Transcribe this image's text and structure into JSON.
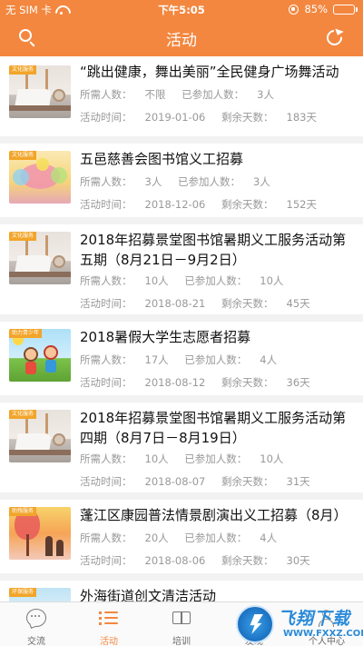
{
  "status_bar": {
    "carrier": "无 SIM 卡",
    "time": "下午5:05",
    "battery": "85%",
    "battery_level": 0.85
  },
  "nav": {
    "title": "活动",
    "search_icon": "search-icon",
    "refresh_icon": "refresh-icon"
  },
  "labels": {
    "need": "所需人数：",
    "joined": "已参加人数：",
    "time": "活动时间：",
    "remain": "剩余天数："
  },
  "activities": [
    {
      "title": "“跳出健康，舞出美丽”全民健身广场舞活动",
      "need": "不限",
      "joined": "3人",
      "date": "2019-01-06",
      "remain": "183天",
      "thumb_tag": "文化服务",
      "thumb_art": "book"
    },
    {
      "title": "五邑慈善会图书馆义工招募",
      "need": "3人",
      "joined": "3人",
      "date": "2018-12-06",
      "remain": "152天",
      "thumb_tag": "文化服务",
      "thumb_art": "tree"
    },
    {
      "title": "2018年招募景堂图书馆暑期义工服务活动第五期（8月21日－9月2日）",
      "need": "10人",
      "joined": "10人",
      "date": "2018-08-21",
      "remain": "45天",
      "thumb_tag": "文化服务",
      "thumb_art": "book"
    },
    {
      "title": "2018暑假大学生志愿者招募",
      "need": "17人",
      "joined": "4人",
      "date": "2018-08-12",
      "remain": "36天",
      "thumb_tag": "助力青少年",
      "thumb_art": "kids"
    },
    {
      "title": "2018年招募景堂图书馆暑期义工服务活动第四期（8月7日－8月19日）",
      "need": "10人",
      "joined": "10人",
      "date": "2018-08-07",
      "remain": "31天",
      "thumb_tag": "文化服务",
      "thumb_art": "book"
    },
    {
      "title": "蓬江区康园普法情景剧演出义工招募（8月）",
      "need": "20人",
      "joined": "4人",
      "date": "2018-08-06",
      "remain": "30天",
      "thumb_tag": "助残服务",
      "thumb_art": "sunset"
    },
    {
      "title": "外海街道创文清洁活动",
      "need": "",
      "joined": "",
      "date": "",
      "remain": "",
      "thumb_tag": "环保服务",
      "thumb_art": "clean"
    }
  ],
  "tabs": [
    {
      "label": "交流",
      "icon": "chat-icon"
    },
    {
      "label": "活动",
      "icon": "list-icon",
      "active": true
    },
    {
      "label": "培训",
      "icon": "book-icon"
    },
    {
      "label": "发现",
      "icon": "discover-icon"
    },
    {
      "label": "个人中心",
      "icon": "user-icon"
    }
  ],
  "watermark": {
    "brand": "飞翔下载",
    "url": "WWW.FXXZ.COM"
  }
}
